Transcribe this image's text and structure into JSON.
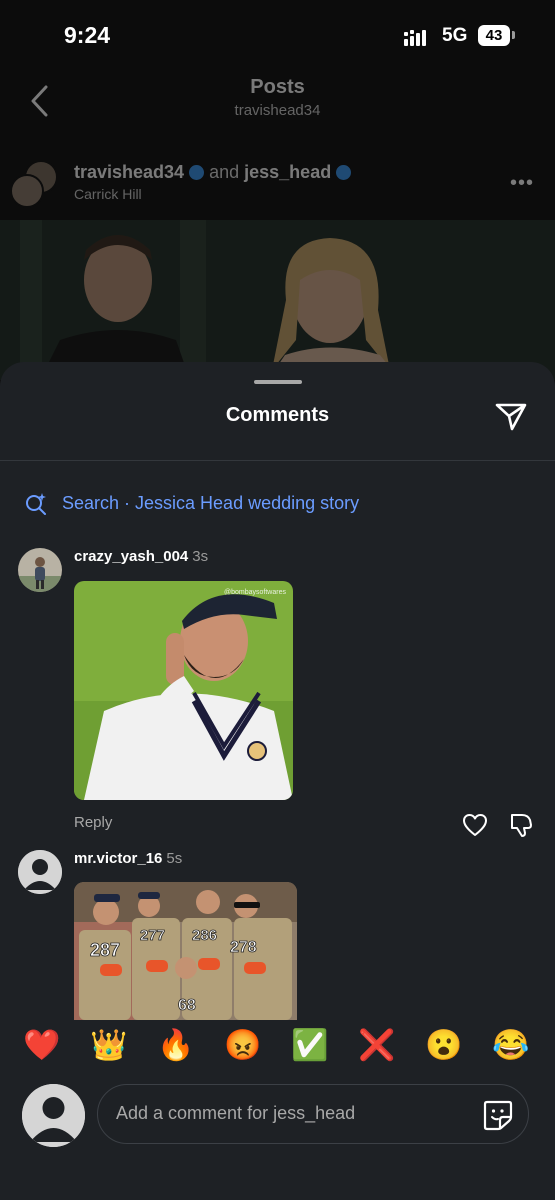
{
  "status_bar": {
    "time": "9:24",
    "network": "5G",
    "battery": "43"
  },
  "header": {
    "title": "Posts",
    "subtitle": "travishead34"
  },
  "post": {
    "user1": "travishead34",
    "and": "and",
    "user2": "jess_head",
    "location": "Carrick Hill"
  },
  "comments_sheet": {
    "title": "Comments",
    "search_text": "Search · Jessica Head wedding story",
    "comments": [
      {
        "user": "crazy_yash_004",
        "time": "3s",
        "gif_watermark": "@bombaysoftwares",
        "reply_label": "Reply"
      },
      {
        "user": "mr.victor_16",
        "time": "5s",
        "gif_numbers": [
          "287",
          "277",
          "286",
          "278",
          "68"
        ]
      }
    ]
  },
  "emoji_bar": [
    "❤️",
    "👑",
    "🔥",
    "😡",
    "✅",
    "❌",
    "😮",
    "😂"
  ],
  "composer": {
    "placeholder": "Add a comment for jess_head"
  },
  "colors": {
    "accent": "#6b9cff",
    "sheet_bg": "#1e2125",
    "verified": "#3897f0"
  }
}
